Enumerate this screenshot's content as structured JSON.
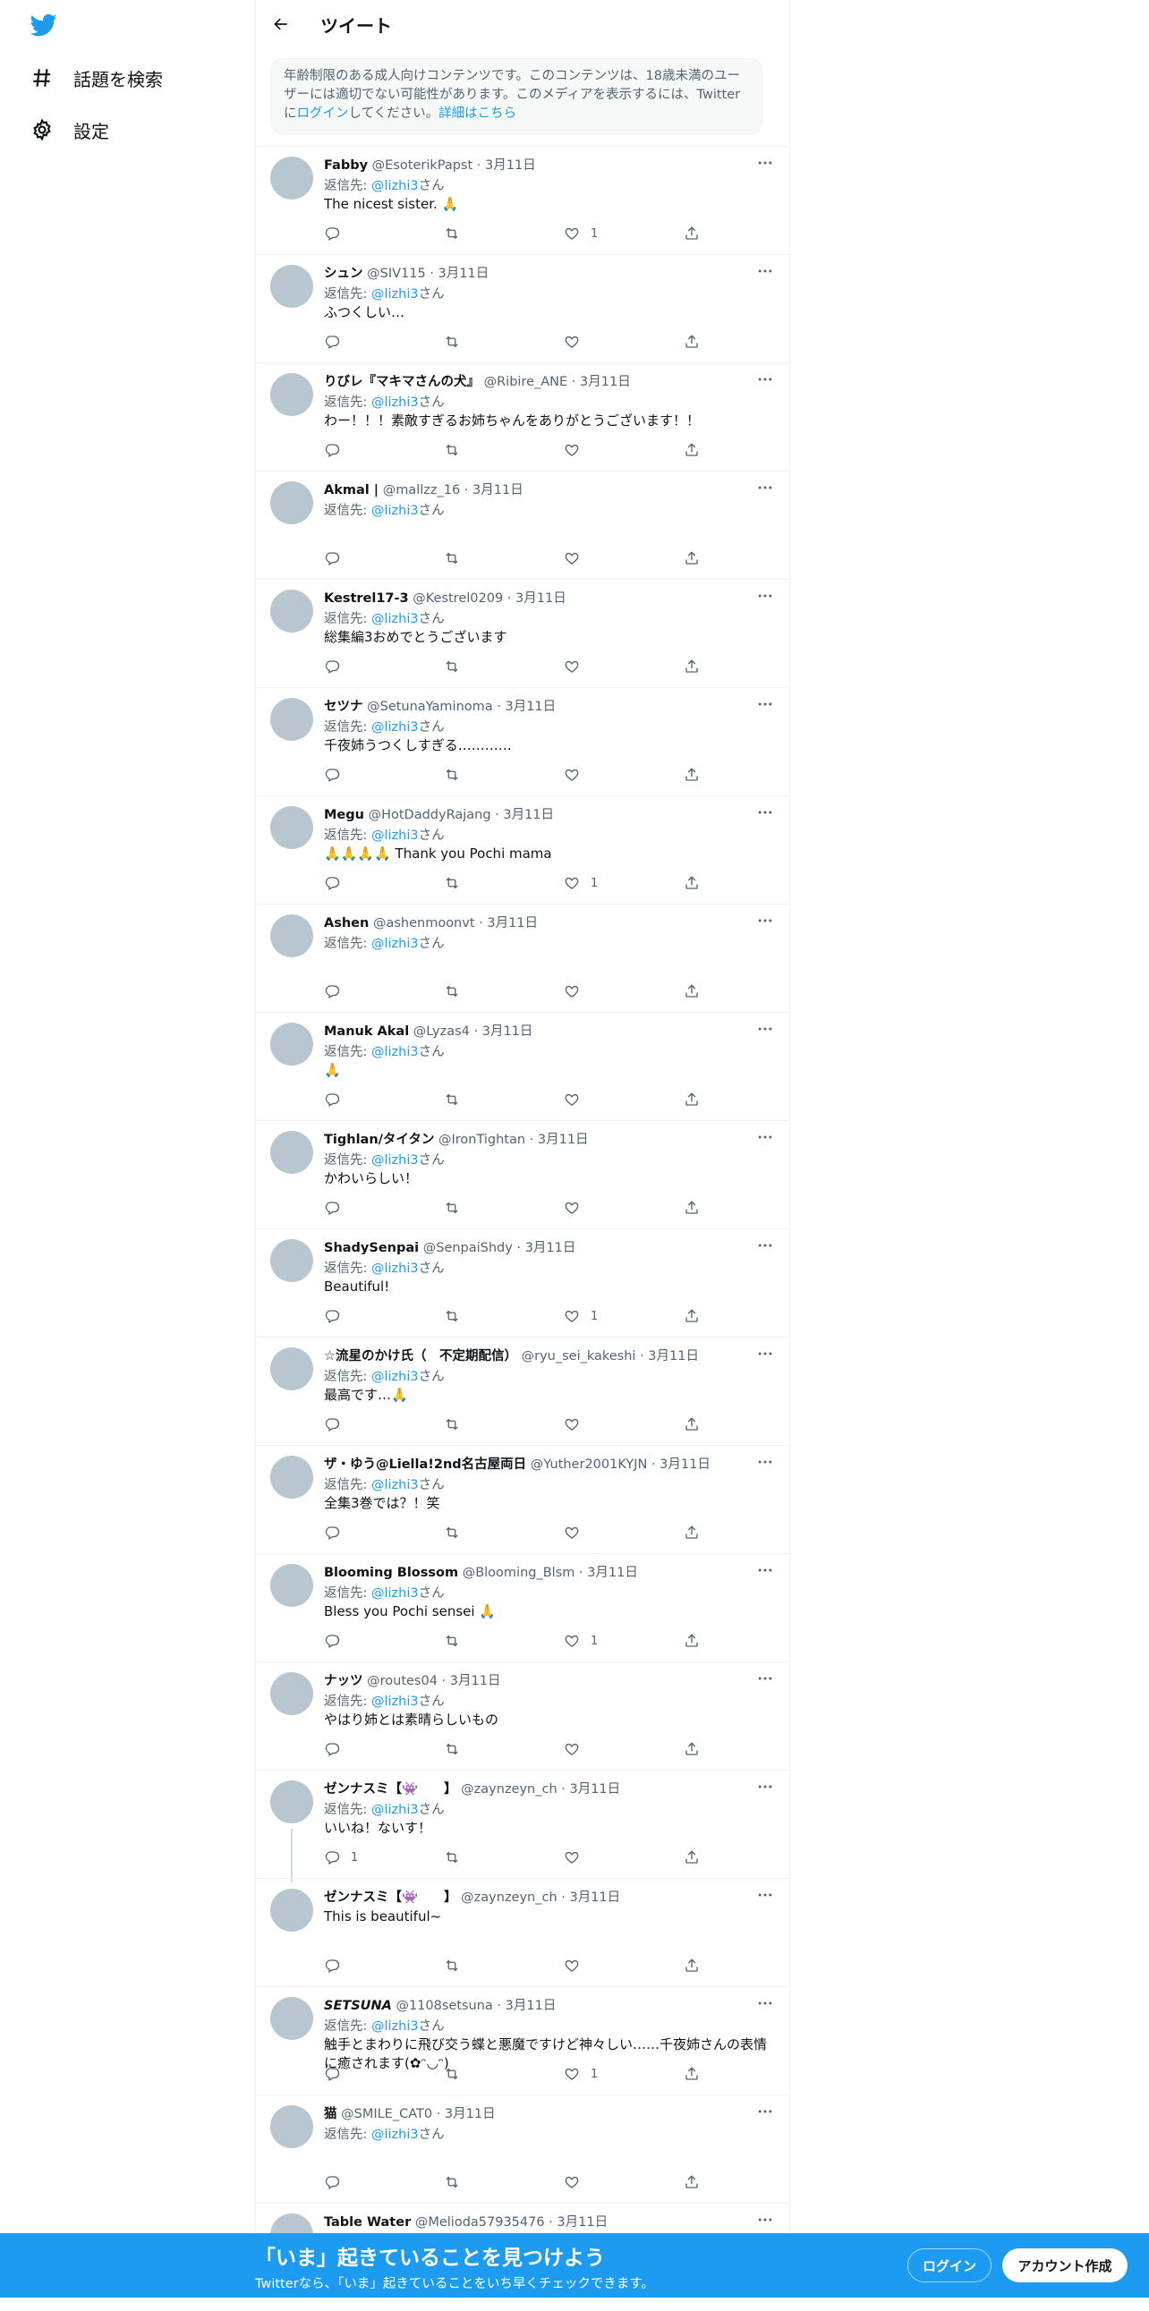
{
  "sidebar": {
    "items": [
      {
        "label": "話題を検索",
        "icon": "hashtag-icon"
      },
      {
        "label": "設定",
        "icon": "gear-icon"
      }
    ]
  },
  "header": {
    "title": "ツイート"
  },
  "warning": {
    "text": "年齢制限のある成人向けコンテンツです。このコンテンツは、18歳未満のユーザーには適切でない可能性があります。このメディアを表示するには、Twitterに",
    "login_link": "ログイン",
    "text2": "してください。",
    "details_link": "詳細はこちら"
  },
  "tweets": [
    {
      "name": "Fabby",
      "handle": "@EsoterikPapst",
      "date": "3月11日",
      "reply_prefix": "返信先: ",
      "mention": "@lizhi3",
      "reply_suffix": "さん",
      "text": "The nicest sister. 🙏",
      "likes": "1"
    },
    {
      "name": "シュン",
      "handle": "@SIV115",
      "date": "3月11日",
      "reply_prefix": "返信先: ",
      "mention": "@lizhi3",
      "reply_suffix": "さん",
      "text": "ふつくしい…",
      "likes": ""
    },
    {
      "name": "りびレ『マキマさんの犬』",
      "handle": "@Ribire_ANE",
      "date": "3月11日",
      "reply_prefix": "返信先: ",
      "mention": "@lizhi3",
      "reply_suffix": "さん",
      "text": "わー！！！素敵すぎるお姉ちゃんをありがとうございます！！",
      "likes": ""
    },
    {
      "name": "Akmal |",
      "handle": "@mallzz_16",
      "date": "3月11日",
      "reply_prefix": "返信先: ",
      "mention": "@lizhi3",
      "reply_suffix": "さん",
      "text": "",
      "likes": ""
    },
    {
      "name": "Kestrel17-3",
      "handle": "@Kestrel0209",
      "date": "3月11日",
      "reply_prefix": "返信先: ",
      "mention": "@lizhi3",
      "reply_suffix": "さん",
      "text": "総集編3おめでとうございます",
      "likes": ""
    },
    {
      "name": "セツナ",
      "handle": "@SetunaYaminoma",
      "date": "3月11日",
      "reply_prefix": "返信先: ",
      "mention": "@lizhi3",
      "reply_suffix": "さん",
      "text": "千夜姉うつくしすぎる…………",
      "likes": ""
    },
    {
      "name": "Megu",
      "handle": "@HotDaddyRajang",
      "date": "3月11日",
      "reply_prefix": "返信先: ",
      "mention": "@lizhi3",
      "reply_suffix": "さん",
      "text": "🙏🙏🙏🙏 Thank you Pochi mama",
      "likes": "1"
    },
    {
      "name": "Ashen",
      "handle": "@ashenmoonvt",
      "date": "3月11日",
      "reply_prefix": "返信先: ",
      "mention": "@lizhi3",
      "reply_suffix": "さん",
      "text": "",
      "likes": ""
    },
    {
      "name": "Manuk Akal",
      "handle": "@Lyzas4",
      "date": "3月11日",
      "reply_prefix": "返信先: ",
      "mention": "@lizhi3",
      "reply_suffix": "さん",
      "text": "🙏",
      "likes": ""
    },
    {
      "name": "Tighlan/タイタン",
      "handle": "@IronTightan",
      "date": "3月11日",
      "reply_prefix": "返信先: ",
      "mention": "@lizhi3",
      "reply_suffix": "さん",
      "text": "かわいらしい！",
      "likes": ""
    },
    {
      "name": "ShadySenpai",
      "handle": "@SenpaiShdy",
      "date": "3月11日",
      "reply_prefix": "返信先: ",
      "mention": "@lizhi3",
      "reply_suffix": "さん",
      "text": "Beautiful!",
      "likes": "1"
    },
    {
      "name": "☆流星のかけ氏（　不定期配信）",
      "handle": "@ryu_sei_kakeshi",
      "date": "3月11日",
      "reply_prefix": "返信先: ",
      "mention": "@lizhi3",
      "reply_suffix": "さん",
      "text": "最高です…🙏",
      "likes": ""
    },
    {
      "name": "ザ・ゆう@Liella!2nd名古屋両日",
      "handle": "@Yuther2001KYJN",
      "date": "3月11日",
      "reply_prefix": "返信先: ",
      "mention": "@lizhi3",
      "reply_suffix": "さん",
      "text": "全集3巻では？！笑",
      "likes": ""
    },
    {
      "name": "Blooming Blossom",
      "handle": "@Blooming_Blsm",
      "date": "3月11日",
      "reply_prefix": "返信先: ",
      "mention": "@lizhi3",
      "reply_suffix": "さん",
      "text": "Bless you Pochi sensei 🙏",
      "likes": "1"
    },
    {
      "name": "ナッツ",
      "handle": "@routes04",
      "date": "3月11日",
      "reply_prefix": "返信先: ",
      "mention": "@lizhi3",
      "reply_suffix": "さん",
      "text": "やはり姉とは素晴らしいもの",
      "likes": ""
    },
    {
      "name": "ゼンナスミ【👾　　】",
      "handle": "@zaynzeyn_ch",
      "date": "3月11日",
      "reply_prefix": "返信先: ",
      "mention": "@lizhi3",
      "reply_suffix": "さん",
      "text": "いいね！ないす！",
      "likes": "",
      "replies": "1"
    },
    {
      "name": "ゼンナスミ【👾　　】",
      "handle": "@zaynzeyn_ch",
      "date": "3月11日",
      "reply_prefix": "",
      "mention": "",
      "reply_suffix": "",
      "text": "This is beautiful~",
      "likes": ""
    },
    {
      "name": "𝙎𝙀𝙏𝙎𝙐𝙉𝘼",
      "handle": "@1108setsuna",
      "date": "3月11日",
      "reply_prefix": "返信先: ",
      "mention": "@lizhi3",
      "reply_suffix": "さん",
      "text": "触手とまわりに飛び交う蝶と悪魔ですけど神々しい……千夜姉さんの表情に癒されます(✿ᵔ◡ᵔ)",
      "likes": "1"
    },
    {
      "name": "猫",
      "handle": "@SMILE_CAT0",
      "date": "3月11日",
      "reply_prefix": "返信先: ",
      "mention": "@lizhi3",
      "reply_suffix": "さん",
      "text": "",
      "likes": ""
    },
    {
      "name": "Table Water",
      "handle": "@Melioda57935476",
      "date": "3月11日",
      "reply_prefix": "",
      "mention": "",
      "reply_suffix": "",
      "text": "",
      "likes": ""
    }
  ],
  "banner": {
    "title": "「いま」起きていることを見つけよう",
    "subtitle": "Twitterなら、「いま」起きていることをいち早くチェックできます。",
    "login": "ログイン",
    "signup": "アカウント作成"
  },
  "colors": {
    "accent": "#1d9bf0",
    "text": "#0f1419",
    "muted": "#536471",
    "border": "#eff3f4"
  }
}
